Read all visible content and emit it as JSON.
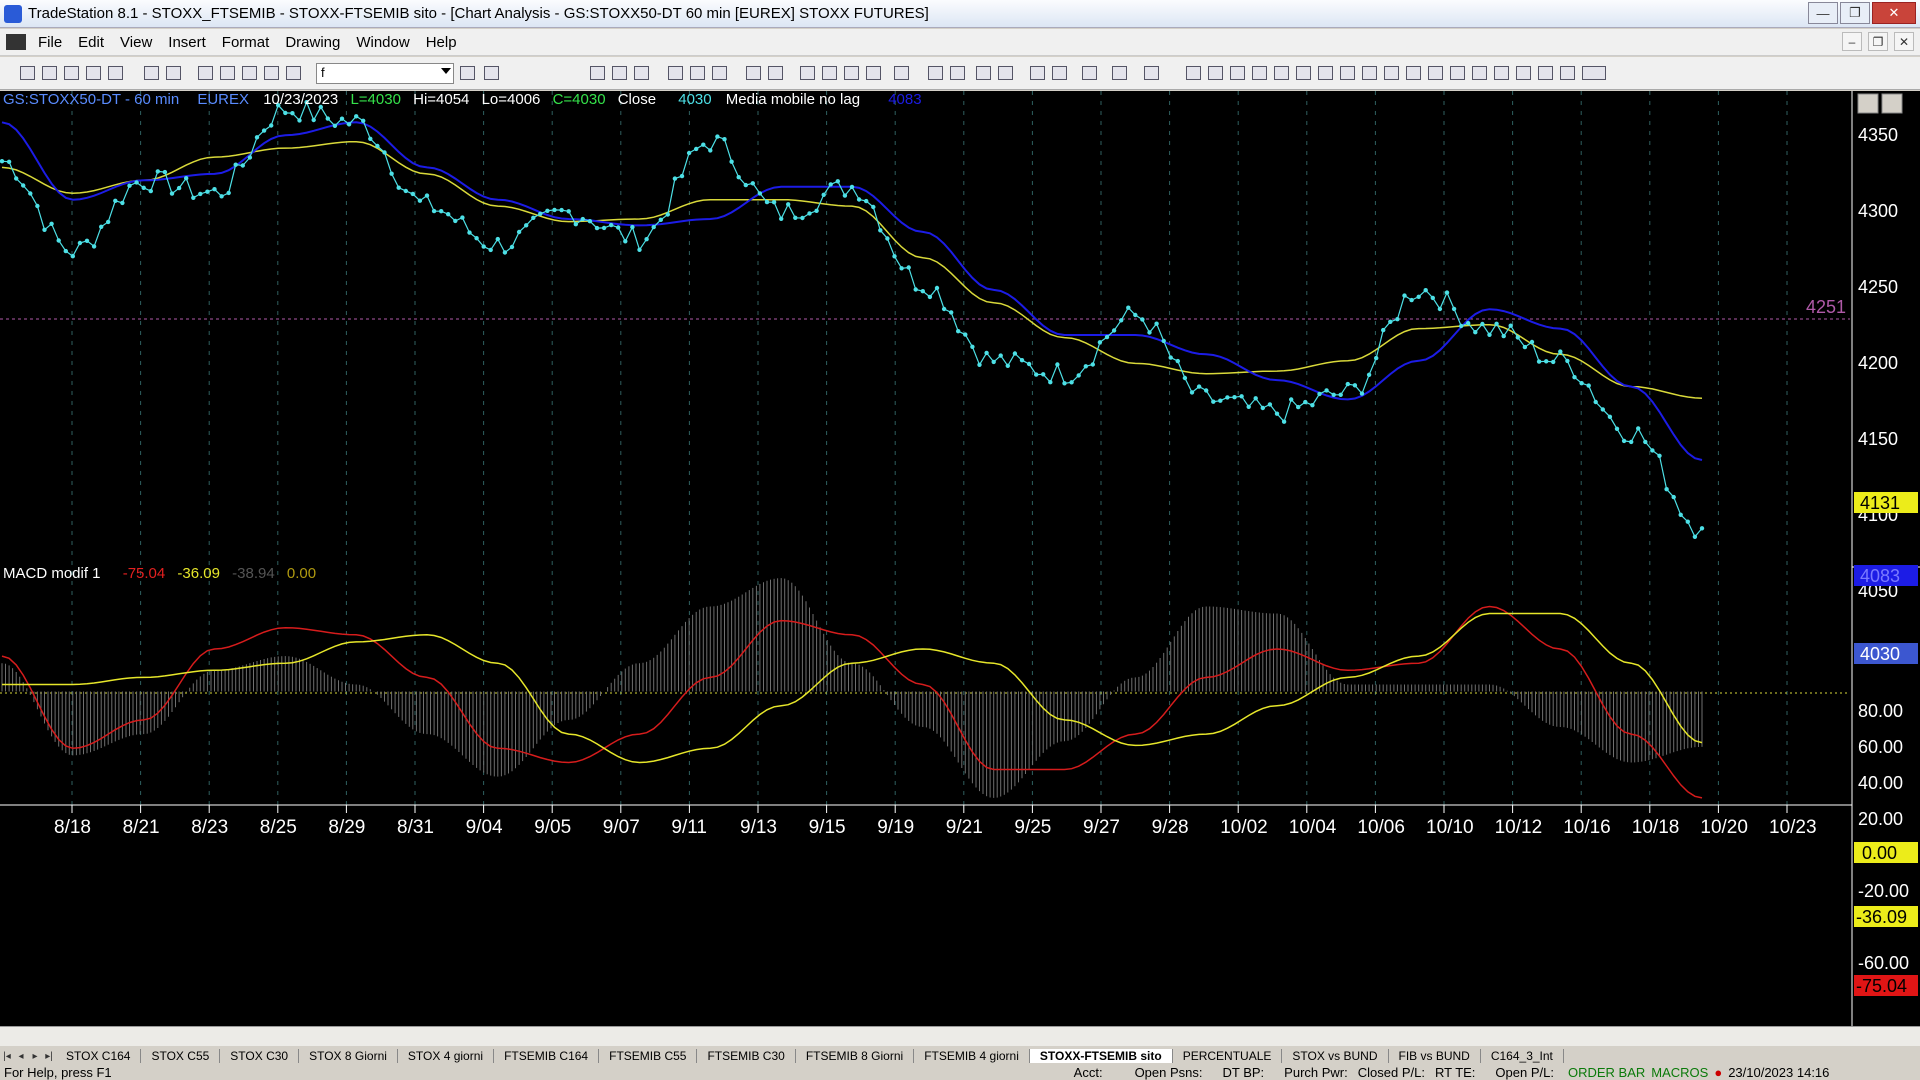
{
  "window": {
    "title": "TradeStation 8.1 - STOXX_FTSEMIB - STOXX-FTSEMIB sito - [Chart Analysis - GS:STOXX50-DT  60 min  [EUREX] STOXX FUTURES]"
  },
  "menu": [
    "File",
    "Edit",
    "View",
    "Insert",
    "Format",
    "Drawing",
    "Window",
    "Help"
  ],
  "toolbar": {
    "symbol_value": "f"
  },
  "price_header": {
    "symbol": "GS:STOXX50-DT - 60 min",
    "exchange": "EUREX",
    "date": "10/23/2023",
    "last": "L=4030",
    "high": "Hi=4054",
    "low": "Lo=4006",
    "close_val": "C=4030",
    "close_label": "Close",
    "close_num": "4030",
    "indicator": "Media mobile no lag",
    "indicator_val": "4083"
  },
  "macd_header": {
    "name": "MACD modif 1",
    "v1": "-75.04",
    "v2": "-36.09",
    "v3": "-38.94",
    "v4": "0.00"
  },
  "price_axis": {
    "ticks": [
      "4350",
      "4300",
      "4250",
      "4200",
      "4150",
      "4100",
      "4050"
    ],
    "hline_label": "4251"
  },
  "price_markers": {
    "yellow": "4131",
    "blue": "4083",
    "cyan": "4030"
  },
  "macd_axis": {
    "ticks": [
      "80.00",
      "60.00",
      "40.00",
      "20.00",
      "0.00",
      "-20.00",
      "-40.00",
      "-60.00"
    ],
    "zero": "0.00",
    "signal": "-36.09",
    "macd": "-75.04"
  },
  "date_axis": [
    "8/18",
    "8/21",
    "8/23",
    "8/25",
    "8/29",
    "8/31",
    "9/04",
    "9/05",
    "9/07",
    "9/11",
    "9/13",
    "9/15",
    "9/19",
    "9/21",
    "9/25",
    "9/27",
    "9/28",
    "10/02",
    "10/04",
    "10/06",
    "10/10",
    "10/12",
    "10/16",
    "10/18",
    "10/20",
    "10/23"
  ],
  "colors": {
    "price": "#4de0e6",
    "blue_ma": "#1c1ce6",
    "yellow_ma": "#d9d93a",
    "macd": "#d61c1c",
    "signal": "#e6e62a",
    "hist": "#8a8a8a",
    "hline": "#b05aa8"
  },
  "chart_data": [
    {
      "type": "line",
      "title": "GS:STOXX50-DT - 60 min",
      "x": [
        "8/18",
        "8/21",
        "8/23",
        "8/25",
        "8/29",
        "8/31",
        "9/04",
        "9/05",
        "9/07",
        "9/11",
        "9/13",
        "9/15",
        "9/19",
        "9/21",
        "9/25",
        "9/27",
        "9/28",
        "10/02",
        "10/04",
        "10/06",
        "10/10",
        "10/12",
        "10/16",
        "10/18",
        "10/20"
      ],
      "series": [
        {
          "name": "Close",
          "values": [
            4315,
            4245,
            4300,
            4290,
            4355,
            4345,
            4280,
            4250,
            4275,
            4255,
            4330,
            4275,
            4295,
            4220,
            4160,
            4150,
            4195,
            4130,
            4120,
            4135,
            4215,
            4185,
            4160,
            4105,
            4030
          ]
        },
        {
          "name": "Media mobile no lag",
          "values": [
            4345,
            4285,
            4300,
            4305,
            4335,
            4345,
            4310,
            4285,
            4270,
            4265,
            4270,
            4295,
            4295,
            4260,
            4215,
            4180,
            4180,
            4165,
            4145,
            4130,
            4160,
            4200,
            4185,
            4140,
            4083
          ]
        },
        {
          "values": [
            4310,
            4290,
            4300,
            4318,
            4325,
            4330,
            4305,
            4280,
            4268,
            4270,
            4285,
            4285,
            4280,
            4240,
            4205,
            4178,
            4158,
            4150,
            4152,
            4160,
            4185,
            4188,
            4165,
            4140,
            4131
          ]
        }
      ],
      "ylim": [
        4000,
        4360
      ],
      "hline": 4251
    },
    {
      "type": "line",
      "title": "MACD modif 1",
      "x": [
        "8/18",
        "8/21",
        "8/23",
        "8/25",
        "8/29",
        "8/31",
        "9/04",
        "9/05",
        "9/07",
        "9/11",
        "9/13",
        "9/15",
        "9/19",
        "9/21",
        "9/25",
        "9/27",
        "9/28",
        "10/02",
        "10/04",
        "10/06",
        "10/10",
        "10/12",
        "10/16",
        "10/18",
        "10/20"
      ],
      "series": [
        {
          "values": [
            25,
            -40,
            -20,
            30,
            45,
            40,
            10,
            -40,
            -50,
            -30,
            10,
            50,
            40,
            5,
            -55,
            -55,
            -30,
            10,
            30,
            15,
            20,
            60,
            30,
            -30,
            -75
          ]
        },
        {
          "values": [
            5,
            5,
            10,
            15,
            20,
            35,
            40,
            20,
            -30,
            -50,
            -40,
            -10,
            20,
            30,
            20,
            -20,
            -38,
            -30,
            -10,
            10,
            25,
            55,
            55,
            20,
            -36
          ]
        },
        {
          "values": [
            20,
            -45,
            -30,
            15,
            25,
            5,
            -30,
            -60,
            -20,
            20,
            60,
            80,
            20,
            -25,
            -75,
            -35,
            10,
            60,
            55,
            5,
            5,
            5,
            -25,
            -50,
            -39
          ]
        }
      ],
      "ylim": [
        -80,
        85
      ],
      "hline": 0
    }
  ]
}
